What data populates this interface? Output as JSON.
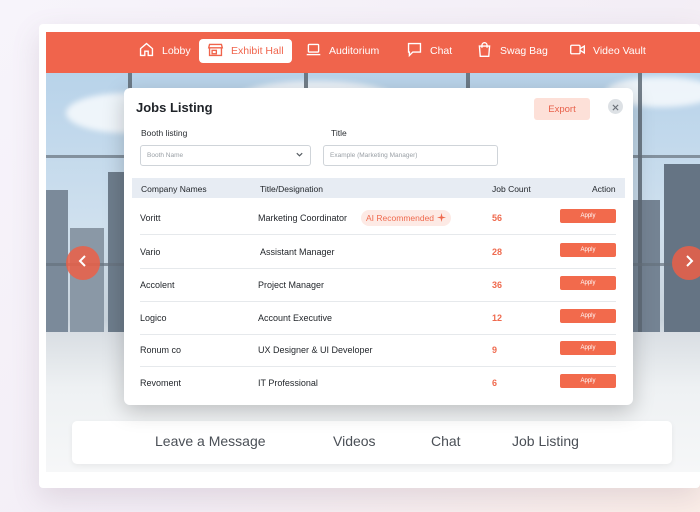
{
  "nav": {
    "items": [
      {
        "label": "Lobby",
        "icon": "home-icon"
      },
      {
        "label": "Exhibit Hall",
        "icon": "storefront-icon"
      },
      {
        "label": "Auditorium",
        "icon": "laptop-icon"
      },
      {
        "label": "Chat",
        "icon": "chat-bubble-icon"
      },
      {
        "label": "Swag Bag",
        "icon": "shopping-bag-icon"
      },
      {
        "label": "Video Vault",
        "icon": "video-camera-icon"
      }
    ],
    "active": "Exhibit Hall"
  },
  "modal": {
    "title": "Jobs Listing",
    "export_label": "Export",
    "close_icon": "close-icon",
    "filters": {
      "booth_label": "Booth listing",
      "booth_value": "Booth Name",
      "title_label": "Title",
      "title_placeholder": "Example (Marketing Manager)"
    },
    "table": {
      "headers": [
        "Company Names",
        "Title/Designation",
        "Job Count",
        "Action"
      ],
      "rows": [
        {
          "company": "Voritt",
          "title": "Marketing Coordinator",
          "badge": "AI Recommended",
          "count": "56",
          "action": "Apply"
        },
        {
          "company": "Vario",
          "title": " Assistant Manager",
          "count": "28",
          "action": "Apply"
        },
        {
          "company": "Accolent",
          "title": "Project Manager",
          "count": "36",
          "action": "Apply"
        },
        {
          "company": "Logico",
          "title": "Account Executive",
          "count": "12",
          "action": "Apply"
        },
        {
          "company": "Ronum co",
          "title": "UX Designer & UI Developer",
          "count": "9",
          "action": "Apply"
        },
        {
          "company": "Revoment",
          "title": "IT Professional",
          "count": "6",
          "action": "Apply"
        }
      ]
    }
  },
  "bottom_tabs": [
    "Leave a Message",
    "Videos",
    "Chat",
    "Job Listing"
  ],
  "colors": {
    "accent": "#f0644c",
    "accent_soft": "#fde0d8",
    "header_row": "#e7ecf3",
    "text": "#1f2328"
  }
}
